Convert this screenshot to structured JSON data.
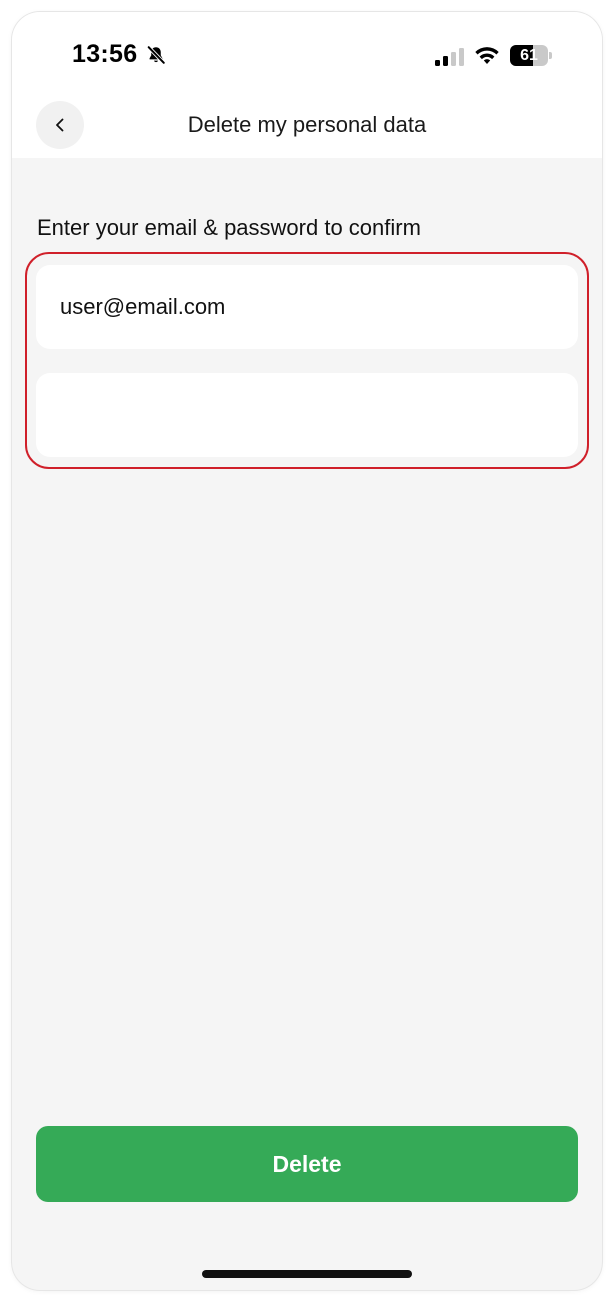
{
  "status_bar": {
    "time": "13:56",
    "battery_level": "61",
    "battery_fraction": 0.61,
    "icons": [
      "bell-slash-icon",
      "cellular-signal-icon",
      "wifi-icon",
      "battery-icon"
    ]
  },
  "header": {
    "title": "Delete my personal data",
    "back_icon": "chevron-left-icon"
  },
  "form": {
    "label": "Enter your email & password to confirm",
    "email_value": "user@email.com",
    "password_value": ""
  },
  "actions": {
    "delete_label": "Delete"
  },
  "colors": {
    "accent_green": "#35aa57",
    "error_red": "#d0202a",
    "background": "#f5f5f5"
  }
}
